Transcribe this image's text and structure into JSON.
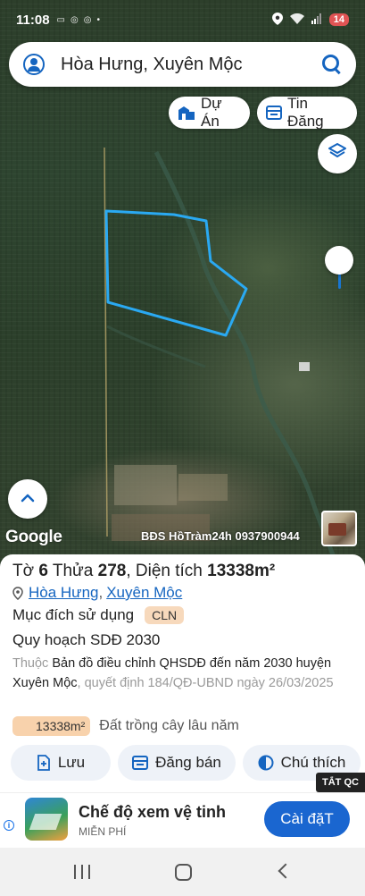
{
  "status_bar": {
    "time": "11:08",
    "notification_icons": [
      "zalo-icon",
      "chrome-icon",
      "chrome-icon",
      "dot-icon"
    ],
    "battery": "14",
    "battery_color": "#e05454"
  },
  "search": {
    "query": "Hòa Hưng, Xuyên Mộc"
  },
  "chips": {
    "du_an": "Dự Án",
    "tin_dang": "Tin Đăng"
  },
  "map": {
    "attribution": "Google",
    "watermark": "BĐS HồTràm24h 0937900944",
    "parcel_outline_color": "#2aa9f2"
  },
  "parcel": {
    "to_label": "Tờ",
    "to_value": "6",
    "thua_label": "Thửa",
    "thua_value": "278",
    "area_label": "Diện tích",
    "area_value": "13338m²",
    "location": {
      "ward": "Hòa Hưng",
      "separator": ",",
      "district": "Xuyên Mộc"
    },
    "purpose_label": "Mục đích sử dụng",
    "purpose_code": "CLN",
    "plan_label": "Quy hoạch SDĐ 2030",
    "desc": {
      "prefix": "Thuộc",
      "map_name": "Bản đồ điều chỉnh QHSDĐ đến năm 2030 huyện Xuyên Mộc",
      "suffix": ", quyết định 184/QĐ-UBND ngày 26/03/2025"
    },
    "area_badge": "13338m²",
    "land_type": "Đất trồng cây lâu năm"
  },
  "actions": {
    "luu": "Lưu",
    "dang_ban": "Đăng bán",
    "chu_thich": "Chú thích"
  },
  "ad": {
    "close_label": "TẮT QC",
    "title": "Chế độ xem vệ tinh",
    "subtitle": "MIỄN PHÍ",
    "install": "Cài đặT",
    "accent": "#1a66d0"
  }
}
